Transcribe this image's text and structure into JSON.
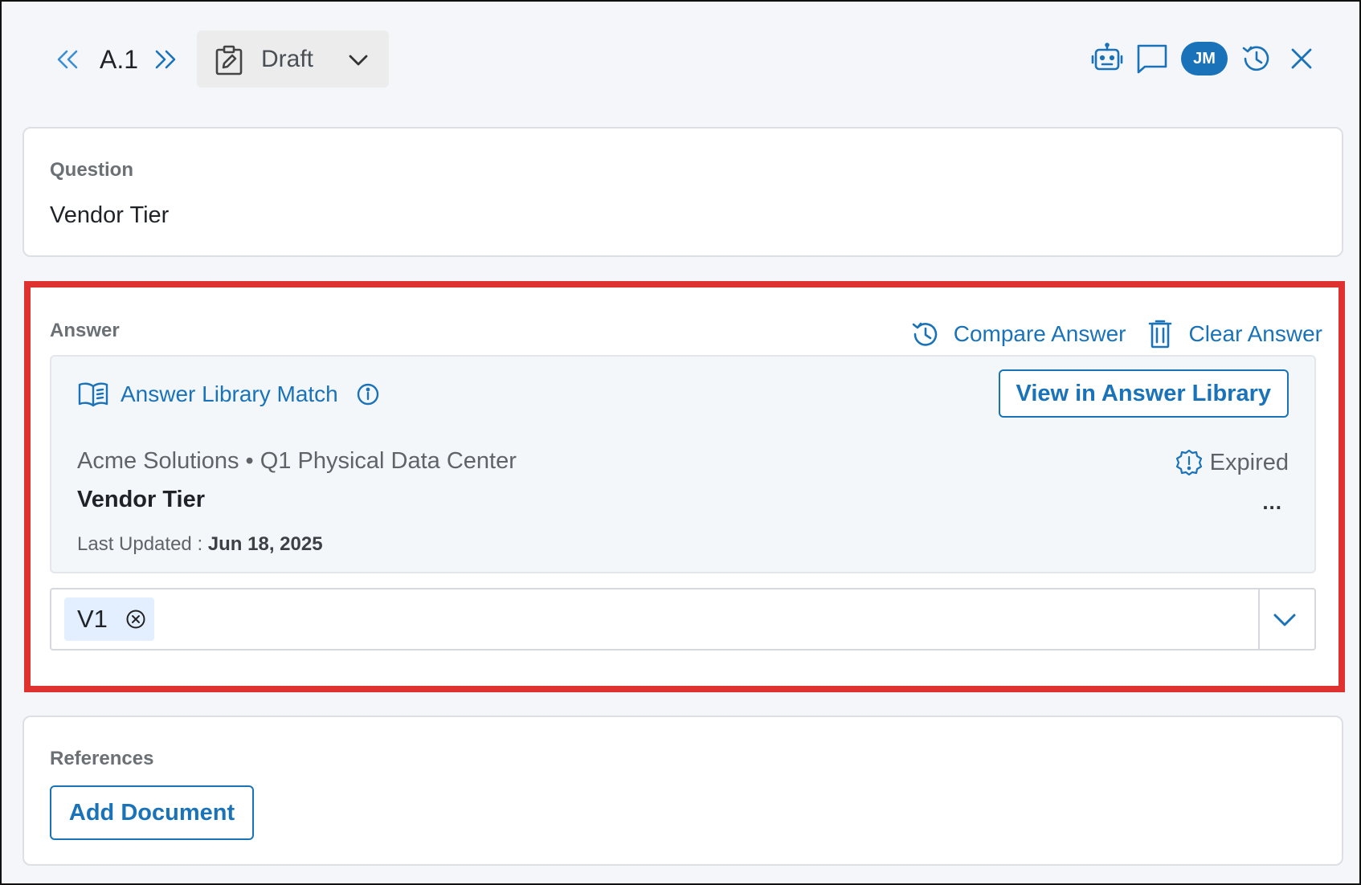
{
  "header": {
    "question_id": "A.1",
    "status_label": "Draft",
    "avatar_initials": "JM",
    "icons": [
      "chevrons-left-icon",
      "chevrons-right-icon",
      "clipboard-edit-icon",
      "chevron-down-icon",
      "robot-icon",
      "comment-icon",
      "history-icon",
      "close-icon"
    ]
  },
  "question": {
    "label": "Question",
    "text": "Vendor Tier"
  },
  "answer": {
    "label": "Answer",
    "compare_label": "Compare Answer",
    "clear_label": "Clear Answer",
    "match": {
      "title": "Answer Library Match",
      "view_button": "View in Answer Library",
      "source": "Acme Solutions • Q1 Physical Data Center",
      "entry_title": "Vendor Tier",
      "status": "Expired",
      "more": "...",
      "last_updated_label": "Last Updated :",
      "last_updated_value": "Jun 18, 2025"
    },
    "version": {
      "selected": "V1"
    }
  },
  "references": {
    "label": "References",
    "add_button": "Add Document"
  },
  "colors": {
    "accent": "#1a73b8",
    "highlight_border": "#e03131",
    "chip_bg": "#e3efff"
  }
}
